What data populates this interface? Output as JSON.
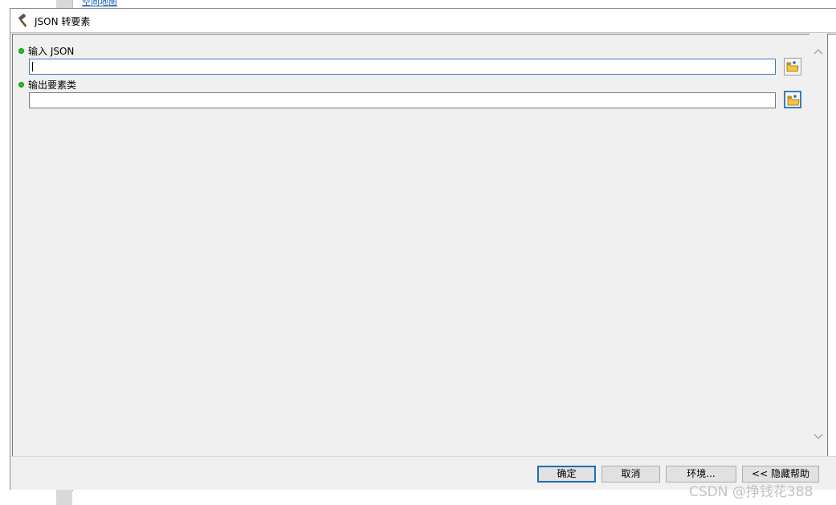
{
  "background": {
    "link_text": "空间地图"
  },
  "dialog": {
    "title": "JSON 转要素",
    "title_icon": "hammer-icon"
  },
  "fields": [
    {
      "label": "输入 JSON",
      "value": "",
      "required": true,
      "browse_icon": "folder-browse-icon"
    },
    {
      "label": "输出要素类",
      "value": "",
      "required": true,
      "browse_icon": "folder-browse-icon"
    }
  ],
  "buttons": {
    "ok": "确定",
    "cancel": "取消",
    "environments": "环境...",
    "hide_help": "<< 隐藏帮助"
  },
  "watermark": "CSDN @挣钱花388",
  "colors": {
    "required_dot": "#1ec51e",
    "focus_border": "#3d7ab8",
    "dialog_bg": "#f0f0f0"
  }
}
